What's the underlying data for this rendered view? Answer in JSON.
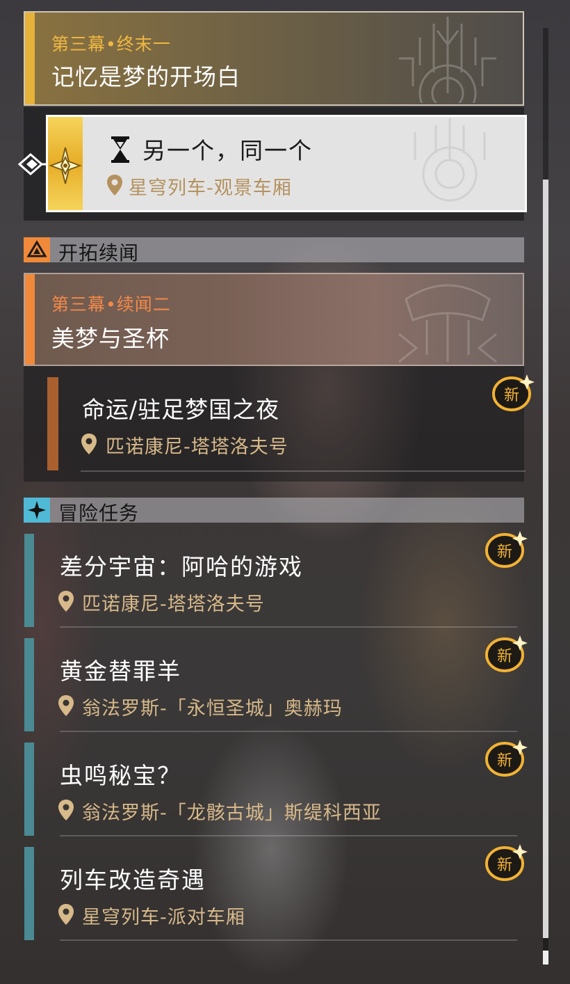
{
  "main_quest": {
    "chapter": "第三幕•终末一",
    "title": "记忆是梦的开场白",
    "sub_quest": {
      "title": "另一个，同一个",
      "location": "星穹列车-观景车厢",
      "status_icon": "hourglass-icon",
      "selected": true
    }
  },
  "companion_section": {
    "label": "开拓续闻",
    "icon": "triangle-emblem-icon",
    "accent": "#f08a3a",
    "quest": {
      "chapter": "第三幕•续闻二",
      "title": "美梦与圣杯",
      "sub_quest": {
        "title": "命运/驻足梦国之夜",
        "location": "匹诺康尼-塔塔洛夫号",
        "badge": "新"
      }
    }
  },
  "adventure_section": {
    "label": "冒险任务",
    "icon": "four-point-star-icon",
    "accent": "#4fb9d6",
    "items": [
      {
        "title": "差分宇宙：阿哈的游戏",
        "location": "匹诺康尼-塔塔洛夫号",
        "badge": "新"
      },
      {
        "title": "黄金替罪羊",
        "location": "翁法罗斯-「永恒圣城」奥赫玛",
        "badge": "新"
      },
      {
        "title": "虫鸣秘宝？",
        "location": "翁法罗斯-「龙骸古城」斯缇科西亚",
        "badge": "新"
      },
      {
        "title": "列车改造奇遇",
        "location": "星穹列车-派对车厢",
        "badge": "新"
      }
    ]
  },
  "colors": {
    "main_accent": "#e6b23a",
    "companion_accent": "#f08a3a",
    "adventure_accent": "#4b8a93",
    "location_text": "#d7b98a",
    "badge": "#f2b233"
  }
}
